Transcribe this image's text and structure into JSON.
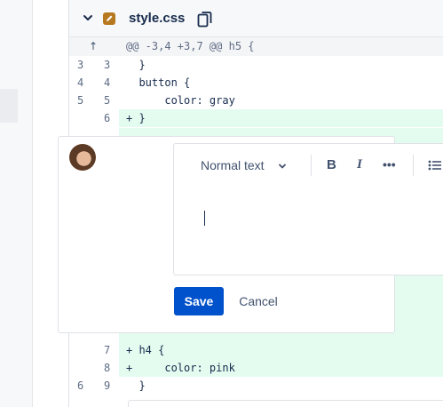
{
  "file": {
    "name": "style.css",
    "icon": "pencil-edit-icon",
    "icon_color": "#b7791f",
    "copy_icon": "copy-icon",
    "collapse_icon": "chevron-down-icon"
  },
  "hunk": {
    "expand_icon": "↑",
    "header": "@@ -3,4 +3,7 @@ h5 {"
  },
  "lines_top": [
    {
      "old": "3",
      "new": "3",
      "text": "  }",
      "type": "context"
    },
    {
      "old": "4",
      "new": "4",
      "text": "  button {",
      "type": "context"
    },
    {
      "old": "5",
      "new": "5",
      "text": "      color: gray",
      "type": "context"
    },
    {
      "old": "",
      "new": "6",
      "text": "+ }",
      "type": "added"
    }
  ],
  "lines_bottom": [
    {
      "old": "",
      "new": "7",
      "text": "+ h4 {",
      "type": "added"
    },
    {
      "old": "",
      "new": "8",
      "text": "+     color: pink",
      "type": "added"
    },
    {
      "old": "6",
      "new": "9",
      "text": "  }",
      "type": "context"
    }
  ],
  "comment": {
    "avatar": "user-avatar",
    "toolbar": {
      "text_style": "Normal text",
      "bold": "B",
      "italic": "I",
      "more": "•••"
    },
    "save_label": "Save",
    "cancel_label": "Cancel"
  },
  "colors": {
    "added_bg": "#e3fcef",
    "primary": "#0052cc"
  }
}
